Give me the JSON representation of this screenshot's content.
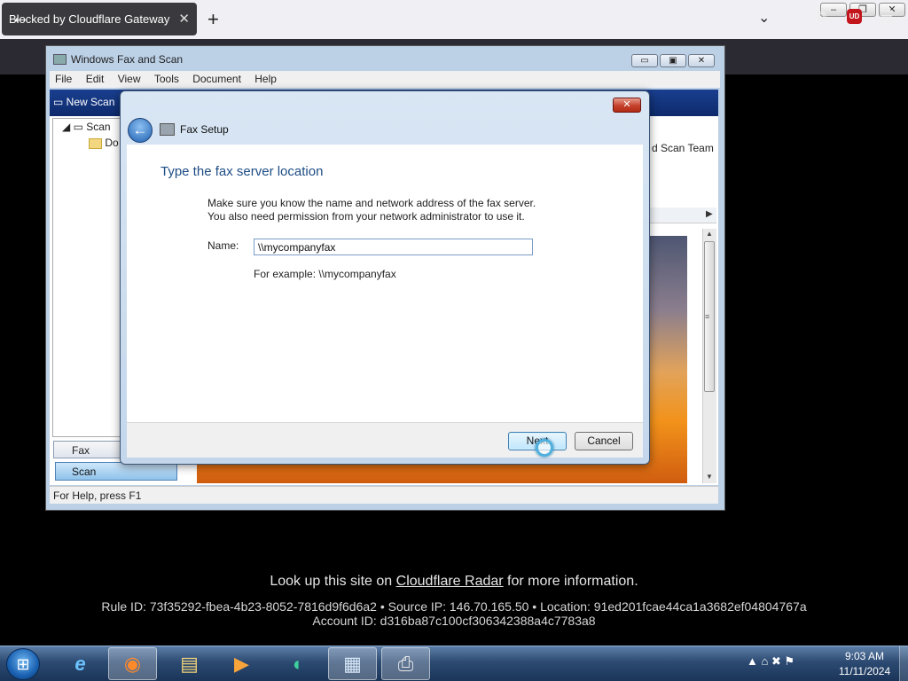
{
  "browser": {
    "tab_title": "Blocked by Cloudflare Gateway",
    "tab_close": "✕",
    "new_tab": "+",
    "tab_list": "⌄",
    "window_controls": {
      "minimize": "–",
      "restore": "❐",
      "close": "✕"
    },
    "back": "←",
    "toolbar_icons": [
      "pocket-icon",
      "timer-icon",
      "extensions-icon",
      "ublock-icon",
      "menu-icon"
    ],
    "toolbar_glyphs": {
      "pocket": "♡",
      "timer": "◔",
      "extensions": "⧉",
      "menu": "☰"
    },
    "ublock_label": "UD"
  },
  "fax_window": {
    "title": "Windows Fax and Scan",
    "controls": {
      "minimize": "▭",
      "restore": "▣",
      "close": "✕"
    },
    "menu": [
      "File",
      "Edit",
      "View",
      "Tools",
      "Document",
      "Help"
    ],
    "new_scan": "New Scan",
    "tree": {
      "root": "Scan",
      "child": "Do"
    },
    "right_header": "d Scan Team",
    "tabs": {
      "fax": "Fax",
      "scan": "Scan"
    },
    "status": "For Help, press F1"
  },
  "dialog": {
    "title": "Fax Setup",
    "close": "✕",
    "heading": "Type the fax server location",
    "desc_line1": "Make sure you know the name and network address of the fax server.",
    "desc_line2": "You also need permission from your network administrator to use it.",
    "name_label": "Name:",
    "name_value": "\\\\mycompanyfax",
    "example": "For example: \\\\mycompanyfax",
    "next_label": "Next",
    "cancel_label": "Cancel"
  },
  "cloudflare": {
    "lookup_prefix": "Look up this site on ",
    "lookup_link": "Cloudflare Radar",
    "lookup_suffix": " for more information.",
    "rule_line": "Rule ID: 73f35292-fbea-4b23-8052-7816d9f6d6a2 • Source IP: 146.70.165.50 • Location: 91ed201fcae44ca1a3682ef04804767a",
    "account_line": "Account ID: d316ba87c100cf306342388a4c7783a8"
  },
  "taskbar": {
    "apps": [
      "internet-explorer-icon",
      "firefox-icon",
      "file-explorer-icon",
      "media-player-icon",
      "media-center-icon",
      "fax-scan-app-icon",
      "printer-icon"
    ],
    "app_glyphs": {
      "ie": "e",
      "firefox": "◉",
      "explorer": "▤",
      "media": "▶",
      "center": "◐",
      "faxscan": "▦",
      "printer": "⎙"
    },
    "tray_glyphs": "▲  ⌂  ✖  ⚑",
    "time": "9:03 AM",
    "date": "11/11/2024"
  }
}
